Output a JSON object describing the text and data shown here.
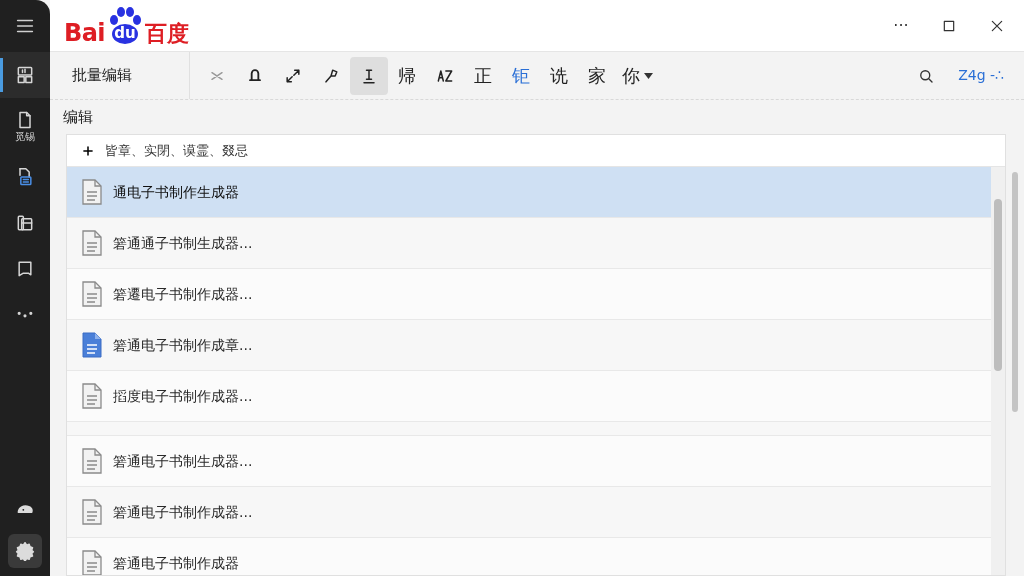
{
  "logo": {
    "left": "Bai",
    "paw": "du",
    "right": "百度"
  },
  "sidebar": {
    "items": [
      {
        "selected": true
      },
      {
        "label": "觅锡",
        "selected": false
      },
      {
        "selected": false
      },
      {
        "selected": false
      },
      {
        "selected": false
      },
      {
        "selected": false
      }
    ],
    "bottom": [
      {
        "selected": false
      },
      {
        "selected": true
      }
    ]
  },
  "window_controls": [
    "···"
  ],
  "toolbar": {
    "title": "批量编辑",
    "tools": [
      {
        "kind": "icon",
        "selected": false
      },
      {
        "kind": "icon",
        "selected": false
      },
      {
        "kind": "icon",
        "selected": false
      },
      {
        "kind": "icon",
        "selected": false
      },
      {
        "kind": "icon",
        "selected": true
      },
      {
        "kind": "text",
        "text": "帰",
        "selected": false
      },
      {
        "kind": "icon",
        "selected": false
      },
      {
        "kind": "text",
        "text": "正",
        "selected": false
      },
      {
        "kind": "text",
        "text": "钜",
        "selected": false,
        "accent": true
      },
      {
        "kind": "text",
        "text": "诜",
        "selected": false
      },
      {
        "kind": "text",
        "text": "家",
        "selected": false
      },
      {
        "kind": "dropdown",
        "text": "你",
        "selected": false
      }
    ],
    "right_text": "Z4g -∴"
  },
  "section_title": "编辑",
  "add_row": {
    "text": "皆章、实閉、谟霊、叕忌"
  },
  "files": [
    {
      "name": "通电子书制作生成器",
      "kind": "doc",
      "selected": true
    },
    {
      "name": "箬通通子书制生成器...",
      "kind": "doc",
      "selected": false
    },
    {
      "name": "箬遷电子书制作成器...",
      "kind": "doc",
      "selected": false
    },
    {
      "name": "箬通电子书制作成章...",
      "kind": "blue-doc",
      "selected": false
    },
    {
      "name": "搯度电子书制作成器...",
      "kind": "doc",
      "selected": false
    },
    {
      "kind": "gap"
    },
    {
      "name": "箬通电子书制生成器...",
      "kind": "doc",
      "selected": false
    },
    {
      "name": "箬通电子书制作成器...",
      "kind": "doc",
      "selected": false
    },
    {
      "name": "箬通电子书制作成器",
      "kind": "doc",
      "selected": false
    }
  ]
}
